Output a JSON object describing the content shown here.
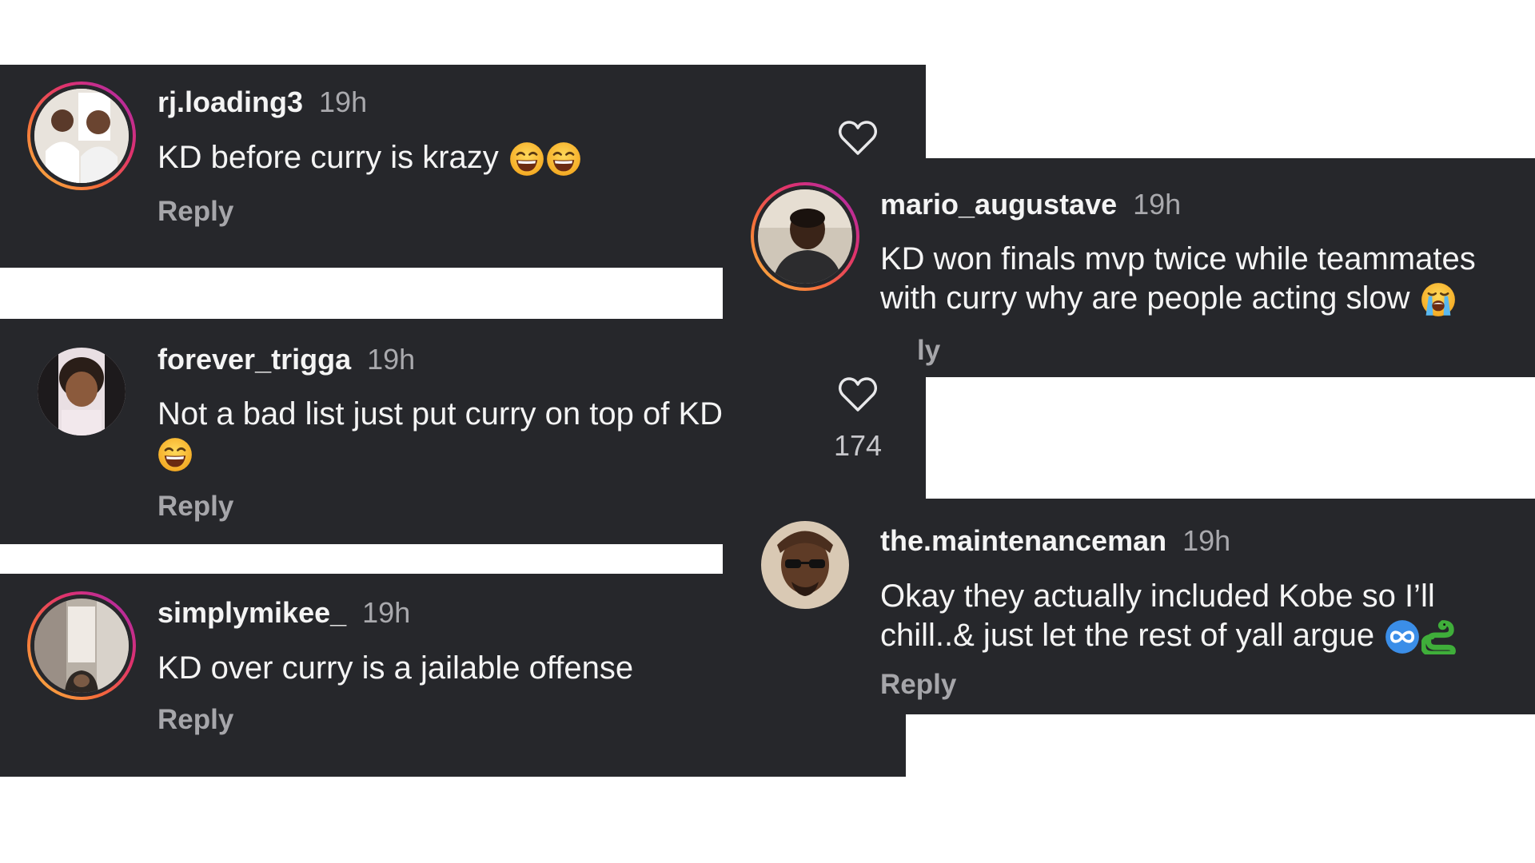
{
  "comments": [
    {
      "username": "rj.loading3",
      "time": "19h",
      "text": "KD before curry is krazy",
      "emojis": [
        "grinning-squinting-face",
        "grinning-squinting-face"
      ],
      "reply": "Reply"
    },
    {
      "username": "forever_trigga",
      "time": "19h",
      "text": "Not a bad list just put curry on top of KD",
      "emojis": [
        "grinning-squinting-face"
      ],
      "reply": "Reply",
      "likes": "174"
    },
    {
      "username": "simplymikee_",
      "time": "19h",
      "text": "KD over curry is a jailable offense",
      "reply": "Reply"
    },
    {
      "username": "mario_augustave",
      "time": "19h",
      "text_line1": "KD won finals mvp twice while teammates",
      "text_line2": "with curry why are people acting slow",
      "emojis": [
        "loudly-crying-face"
      ],
      "reply": "ly"
    },
    {
      "username": "the.maintenanceman",
      "time": "19h",
      "text_line1": "Okay they actually included Kobe so I’ll",
      "text_line2": "chill..& just let the rest of yall argue",
      "emojis": [
        "infinity-icon",
        "snake-icon"
      ],
      "reply": "Reply"
    }
  ],
  "colors": {
    "panel": "#26272b",
    "text": "#f4f4f4",
    "muted": "#a9a9ad",
    "story_ring": [
      "#f9c043",
      "#f56a3a",
      "#e0326d",
      "#a128b8"
    ]
  }
}
